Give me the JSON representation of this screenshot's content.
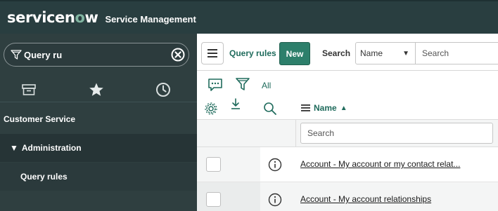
{
  "header": {
    "logo_text_a": "servicen",
    "logo_text_o": "o",
    "logo_text_b": "w",
    "app_title": "Service Management"
  },
  "sidebar": {
    "filter_value": "Query ru",
    "icons": [
      "archive-icon",
      "star-icon",
      "clock-icon"
    ],
    "items": [
      {
        "label": "Customer Service"
      },
      {
        "label": "Administration",
        "expanded": true
      },
      {
        "label": "Query rules"
      }
    ]
  },
  "toolbar": {
    "list_title": "Query rules",
    "new_label": "New",
    "search_label": "Search",
    "field_selected": "Name",
    "search_placeholder": "Search"
  },
  "list": {
    "all_label": "All",
    "column_header": "Name",
    "column_search_placeholder": "Search",
    "rows": [
      {
        "name": "Account - My account or my contact relat..."
      },
      {
        "name": "Account - My account relationships"
      }
    ]
  },
  "colors": {
    "header_bg": "#293e40",
    "sidebar_bg": "#2f3f40",
    "accent": "#2d7f6b",
    "link": "#1f6b5c"
  }
}
